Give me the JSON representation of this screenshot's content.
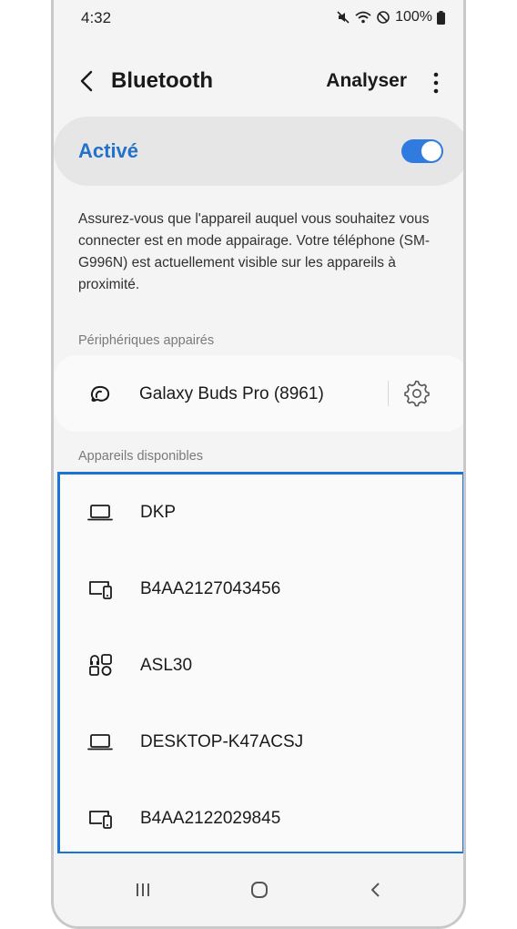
{
  "status_bar": {
    "time": "4:32",
    "battery": "100%"
  },
  "header": {
    "title": "Bluetooth",
    "scan_label": "Analyser"
  },
  "toggle": {
    "label": "Activé",
    "state": "on"
  },
  "description": "Assurez-vous que l'appareil auquel vous souhaitez vous connecter est en mode appairage. Votre téléphone (SM-G996N) est actuellement visible sur les appareils à proximité.",
  "paired": {
    "section_label": "Périphériques appairés",
    "devices": [
      {
        "name": "Galaxy Buds Pro (8961)",
        "icon": "earbuds-icon"
      }
    ]
  },
  "available": {
    "section_label": "Appareils disponibles",
    "devices": [
      {
        "name": "DKP",
        "icon": "laptop-icon"
      },
      {
        "name": "B4AA2127043456",
        "icon": "multi-device-icon"
      },
      {
        "name": "ASL30",
        "icon": "other-devices-icon"
      },
      {
        "name": "DESKTOP-K47ACSJ",
        "icon": "laptop-icon"
      },
      {
        "name": "B4AA2122029845",
        "icon": "multi-device-icon"
      }
    ]
  },
  "colors": {
    "accent": "#2471cc",
    "switch": "#2f7be0",
    "highlight_border": "#1a73d9"
  }
}
